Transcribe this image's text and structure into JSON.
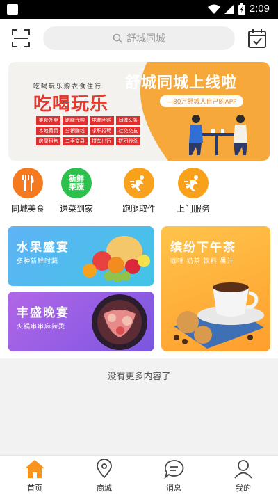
{
  "status": {
    "time": "2:09"
  },
  "search": {
    "placeholder": "舒城同城"
  },
  "banner": {
    "headline": "舒城同城上线啦",
    "pill_text": "—80万舒城人自己的APP",
    "slogan_small": "吃喝玩乐购衣食住行",
    "slogan_big": "吃喝玩乐",
    "tags": [
      "美食外卖",
      "跑腿代购",
      "电商团购",
      "同城头条",
      "本地黄页",
      "分销赚钱",
      "求职招聘",
      "社交交友",
      "房屋租售",
      "二手交易",
      "拼车出行",
      "拼团秒杀"
    ]
  },
  "quick": [
    {
      "label": "同城美食",
      "icon": "fork-knife-icon",
      "color": "#f57a1f"
    },
    {
      "label": "送菜到家",
      "icon": "fresh-produce-icon",
      "color": "#2cc04c",
      "icon_text": "新鲜果蔬"
    },
    {
      "label": "跑腿取件",
      "icon": "runner-icon",
      "color": "#f9a11b"
    },
    {
      "label": "上门服务",
      "icon": "runner-icon",
      "color": "#f9a11b"
    }
  ],
  "cards": [
    {
      "title": "水果盛宴",
      "subtitle": "多种新鲜时蔬"
    },
    {
      "title": "丰盛晚宴",
      "subtitle": "火锅串串麻辣烫"
    },
    {
      "title": "缤纷下午茶",
      "subtitle": "咖啡 奶茶 饮料 果汁"
    }
  ],
  "footer_note": "没有更多内容了",
  "nav": [
    {
      "label": "首页",
      "icon": "home-icon"
    },
    {
      "label": "商城",
      "icon": "map-pin-icon"
    },
    {
      "label": "消息",
      "icon": "chat-bubble-icon"
    },
    {
      "label": "我的",
      "icon": "user-icon"
    }
  ],
  "colors": {
    "accent": "#f7941d",
    "banner_orange": "#f6a93a"
  }
}
